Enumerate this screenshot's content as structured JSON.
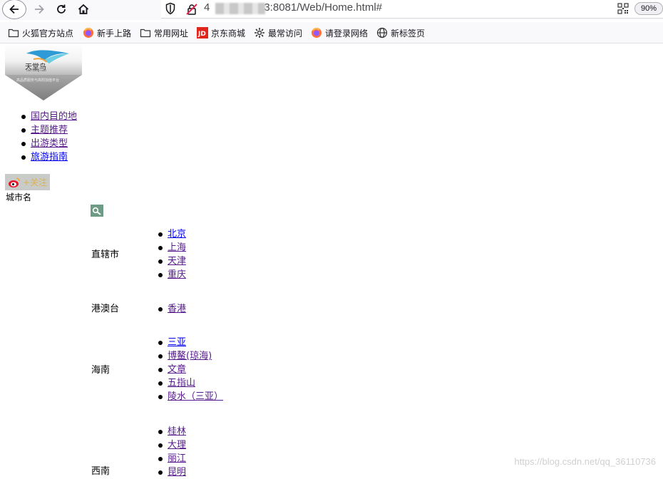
{
  "browser": {
    "url_prefix": "4",
    "url_suffix": "3:8081/Web/Home.html#",
    "zoom": "90%"
  },
  "bookmarks": [
    {
      "label": "火狐官方站点",
      "icon": "folder-icon"
    },
    {
      "label": "新手上路",
      "icon": "firefox-icon"
    },
    {
      "label": "常用网址",
      "icon": "folder-icon"
    },
    {
      "label": "京东商城",
      "icon": "jd-icon"
    },
    {
      "label": "最常访问",
      "icon": "gear-icon"
    },
    {
      "label": "请登录网络",
      "icon": "firefox-icon"
    },
    {
      "label": "新标签页",
      "icon": "globe-icon"
    }
  ],
  "logo": {
    "brand": "天堂鸟",
    "pinyin": "tian tang niao",
    "tagline": "高品质服务与高附加值平台"
  },
  "nav": [
    "国内目的地",
    "主题推荐",
    "出游类型",
    "旅游指南"
  ],
  "weibo": {
    "follow_label": "+关注"
  },
  "search": {
    "city_label": "城市名"
  },
  "regions": [
    {
      "name": "直辖市",
      "cities": [
        "北京",
        "上海",
        "天津",
        "重庆"
      ]
    },
    {
      "name": "港澳台",
      "cities": [
        "香港"
      ]
    },
    {
      "name": "海南",
      "cities": [
        "三亚",
        "博鳌(琼海)",
        "文章",
        "五指山",
        "陵水（三亚）"
      ]
    },
    {
      "name": "西南",
      "cities": [
        "桂林",
        "大理",
        "丽江",
        "昆明"
      ]
    }
  ],
  "watermark": "https://blog.csdn.net/qq_36110736"
}
